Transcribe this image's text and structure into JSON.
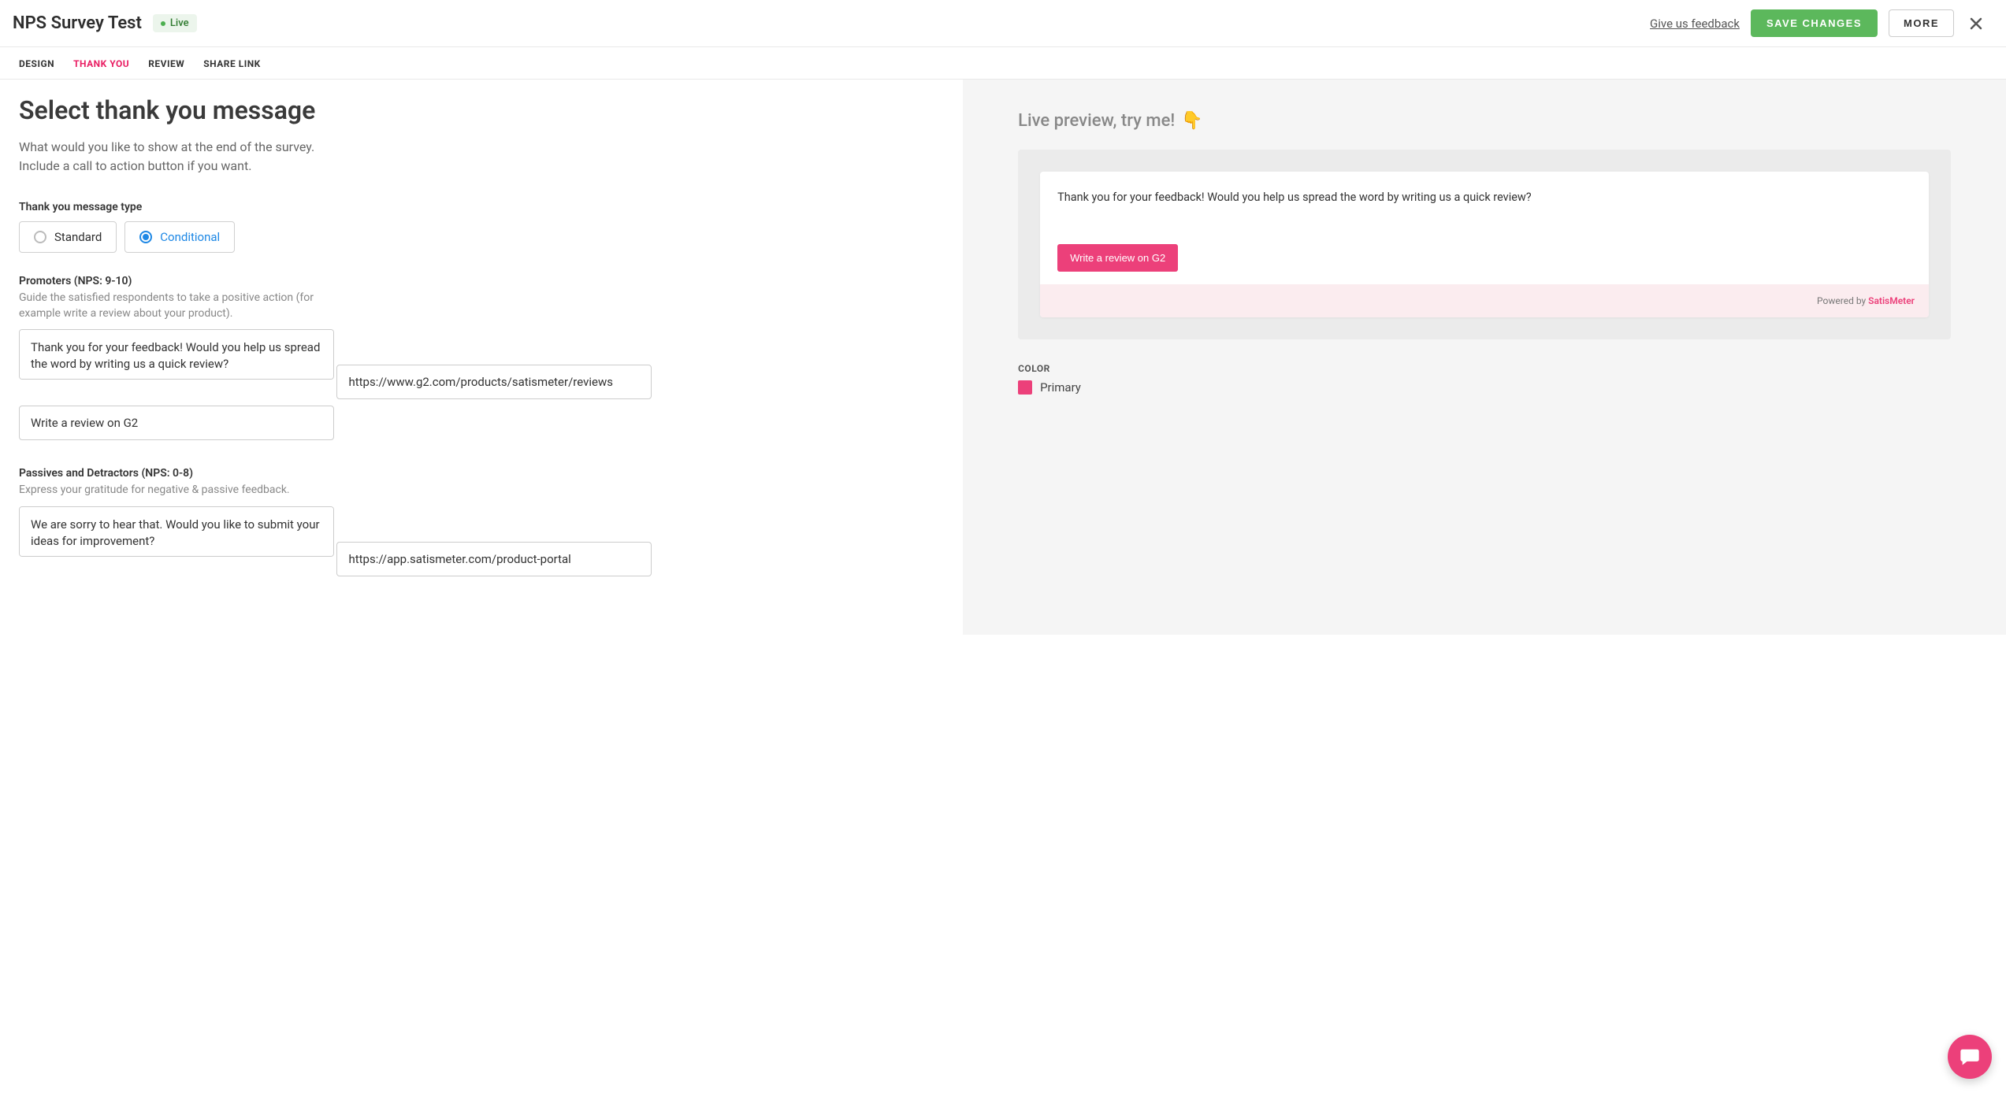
{
  "header": {
    "title": "NPS Survey Test",
    "status_label": "Live",
    "feedback_link": "Give us feedback",
    "save_button": "SAVE CHANGES",
    "more_button": "MORE"
  },
  "tabs": [
    {
      "label": "DESIGN"
    },
    {
      "label": "THANK YOU"
    },
    {
      "label": "REVIEW"
    },
    {
      "label": "SHARE LINK"
    }
  ],
  "page": {
    "title": "Select thank you message",
    "description": "What would you like to show at the end of the survey. Include a call to action button if you want."
  },
  "message_type": {
    "label": "Thank you message type",
    "options": {
      "standard": "Standard",
      "conditional": "Conditional"
    }
  },
  "promoters": {
    "title": "Promoters (NPS: 9-10)",
    "help": "Guide the satisfied respondents to take a positive action (for example write a review about your product).",
    "message": "Thank you for your feedback! Would you help us spread the word by writing us a quick review?",
    "url": "https://www.g2.com/products/satismeter/reviews",
    "button_text": "Write a review on G2"
  },
  "passives": {
    "title": "Passives and Detractors (NPS: 0-8)",
    "help": "Express your gratitude for negative & passive feedback.",
    "message": "We are sorry to hear that. Would you like to submit your ideas for improvement?",
    "url": "https://app.satismeter.com/product-portal"
  },
  "preview": {
    "title": "Live preview, try me!",
    "emoji": "👇",
    "message": "Thank you for your feedback! Would you help us spread the word by writing us a quick review?",
    "cta": "Write a review on G2",
    "powered_by_prefix": "Powered by ",
    "powered_by_brand": "SatisMeter"
  },
  "color": {
    "section_label": "COLOR",
    "name": "Primary",
    "hex": "#ec407a"
  }
}
